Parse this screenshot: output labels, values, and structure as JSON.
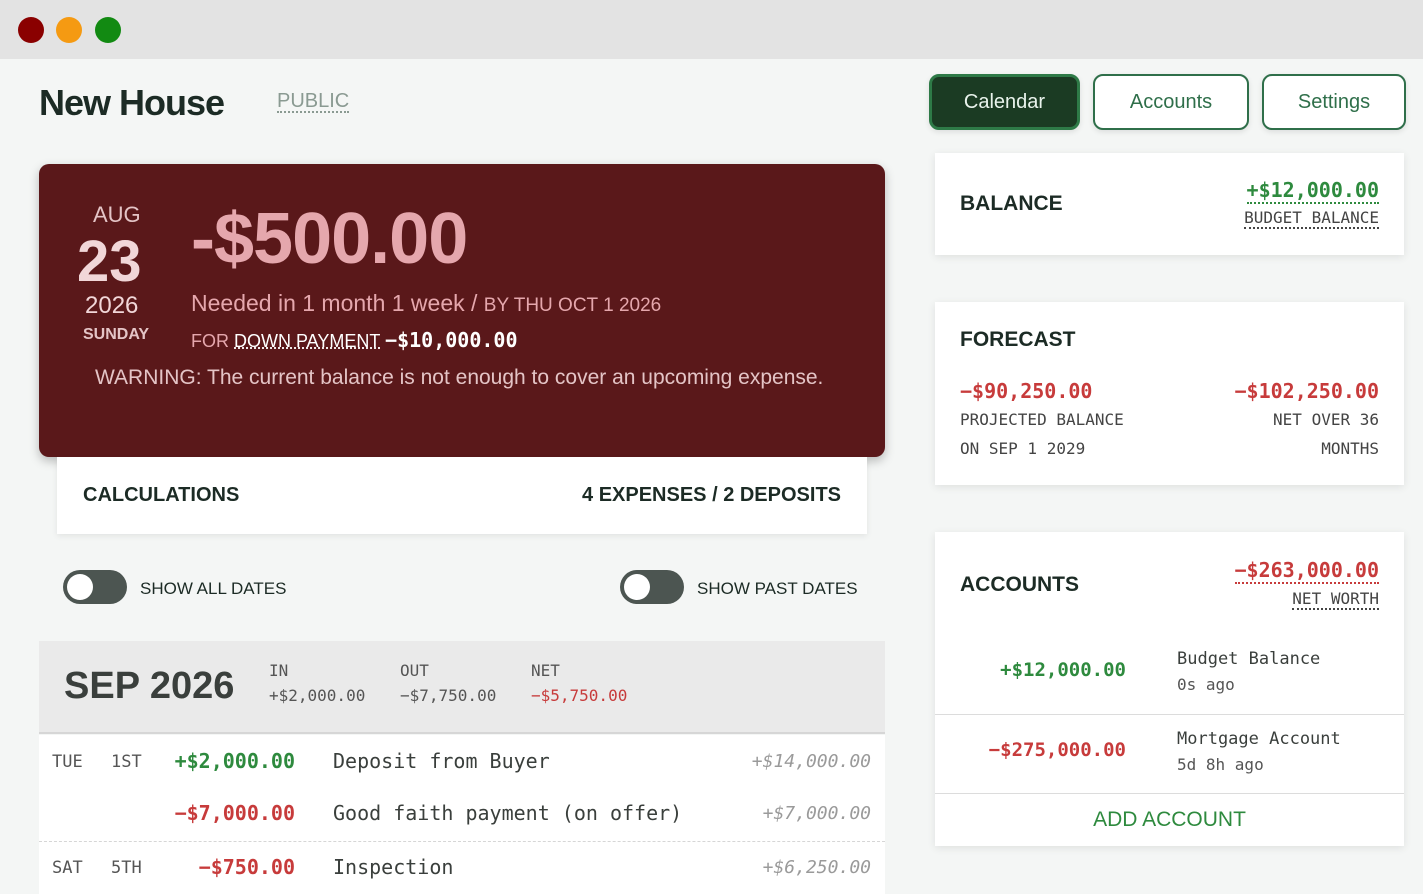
{
  "window": {
    "controls": [
      "close",
      "minimize",
      "maximize"
    ]
  },
  "header": {
    "title": "New House",
    "visibility": "PUBLIC"
  },
  "nav": {
    "calendar": "Calendar",
    "accounts": "Accounts",
    "settings": "Settings"
  },
  "alert": {
    "month": "AUG",
    "day": "23",
    "year": "2026",
    "weekday": "SUNDAY",
    "amount": "-$500.00",
    "needed": "Needed in 1 month 1 week /",
    "by": "BY THU OCT 1 2026",
    "for_label": "FOR",
    "for_link": "DOWN PAYMENT",
    "for_amount": "−$10,000.00",
    "warning": "WARNING: The current balance is not enough to cover an upcoming expense."
  },
  "calculations": {
    "label": "CALCULATIONS",
    "summary": "4 EXPENSES / 2 DEPOSITS"
  },
  "toggles": {
    "show_all_dates": "SHOW ALL DATES",
    "show_past_dates": "SHOW PAST DATES"
  },
  "month": {
    "name": "SEP 2026",
    "in_label": "IN",
    "in_value": "+$2,000.00",
    "out_label": "OUT",
    "out_value": "−$7,750.00",
    "net_label": "NET",
    "net_value": "−$5,750.00"
  },
  "rows": [
    {
      "dow": "TUE",
      "day": "1ST",
      "amount": "+$2,000.00",
      "desc": "Deposit from Buyer",
      "running": "+$14,000.00"
    },
    {
      "dow": "",
      "day": "",
      "amount": "−$7,000.00",
      "desc": "Good faith payment (on offer)",
      "running": "+$7,000.00"
    },
    {
      "dow": "SAT",
      "day": "5TH",
      "amount": "−$750.00",
      "desc": "Inspection",
      "running": "+$6,250.00"
    }
  ],
  "balance": {
    "title": "BALANCE",
    "value": "+$12,000.00",
    "sub": "BUDGET BALANCE"
  },
  "forecast": {
    "title": "FORECAST",
    "projected_value": "−$90,250.00",
    "projected_label": "PROJECTED BALANCE",
    "projected_date": "ON SEP 1 2029",
    "net_value": "−$102,250.00",
    "net_label": "NET OVER 36",
    "net_label2": "MONTHS"
  },
  "accounts": {
    "title": "ACCOUNTS",
    "net_worth_value": "−$263,000.00",
    "net_worth_label": "NET WORTH",
    "items": [
      {
        "amount": "+$12,000.00",
        "name": "Budget Balance",
        "ago": "0s ago"
      },
      {
        "amount": "−$275,000.00",
        "name": "Mortgage Account",
        "ago": "5d 8h ago"
      }
    ],
    "add": "ADD ACCOUNT"
  },
  "colors": {
    "accent": "#2f6f4a",
    "alert_bg": "#5a181a",
    "positive": "#2e8a3e",
    "negative": "#c73b3b"
  }
}
